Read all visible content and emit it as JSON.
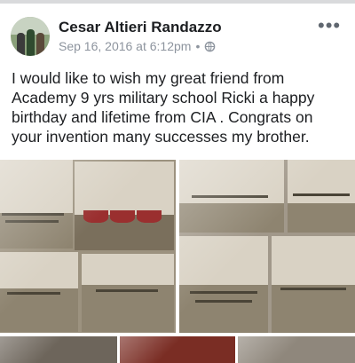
{
  "post": {
    "author": "Cesar Altieri Randazzo",
    "timestamp": "Sep 16, 2016 at 6:12pm",
    "separator": "•",
    "privacy_icon": "globe-icon",
    "more_icon": "ellipsis-icon",
    "text": "I would like to wish my great friend from Academy 9 yrs military school Ricki a happy birthday and lifetime from CIA . Congrats on your invention many successes my brother."
  },
  "photos": {
    "count_visible": 4,
    "description_icons": [
      "photo-collage-military-academy"
    ]
  },
  "colors": {
    "name": "#1c1e21",
    "meta": "#8d949e",
    "divider": "#d9dadc"
  }
}
